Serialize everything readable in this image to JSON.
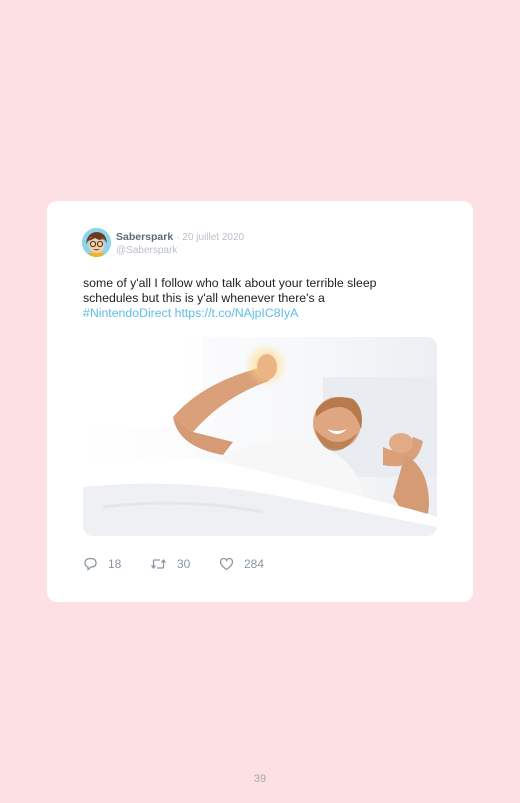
{
  "tweet": {
    "author_name": "Saberspark",
    "separator": "·",
    "date": "20 juillet 2020",
    "handle": "@Saberspark",
    "text_plain": "some of y'all I follow who talk about your terrible sleep schedules but this is y'all whenever there's a",
    "hashtag": "#NintendoDirect",
    "link": "https://t.co/NAjpIC8IyA",
    "media_icon": "photo-of-man-stretching-in-bed"
  },
  "actions": {
    "replies": "18",
    "retweets": "30",
    "likes": "284"
  },
  "page": {
    "number": "39"
  },
  "colors": {
    "background": "#fde0e4",
    "card": "#ffffff",
    "link": "#5cbde9",
    "muted": "#8a96a3"
  }
}
